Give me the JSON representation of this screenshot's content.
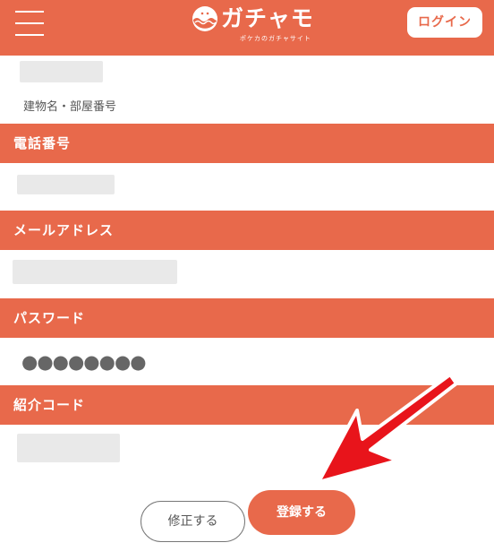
{
  "header": {
    "logo_text": "ガチャモ",
    "logo_sub": "ポケカのガチャサイト",
    "login_label": "ログイン"
  },
  "address": {
    "building_caption": "建物名・部屋番号"
  },
  "sections": {
    "phone": "電話番号",
    "email": "メールアドレス",
    "password": "パスワード",
    "referral": "紹介コード"
  },
  "password_value": "●●●●●●●●",
  "buttons": {
    "edit": "修正する",
    "register": "登録する"
  },
  "colors": {
    "brand": "#e8694b",
    "annotation_arrow": "#e8141b"
  }
}
